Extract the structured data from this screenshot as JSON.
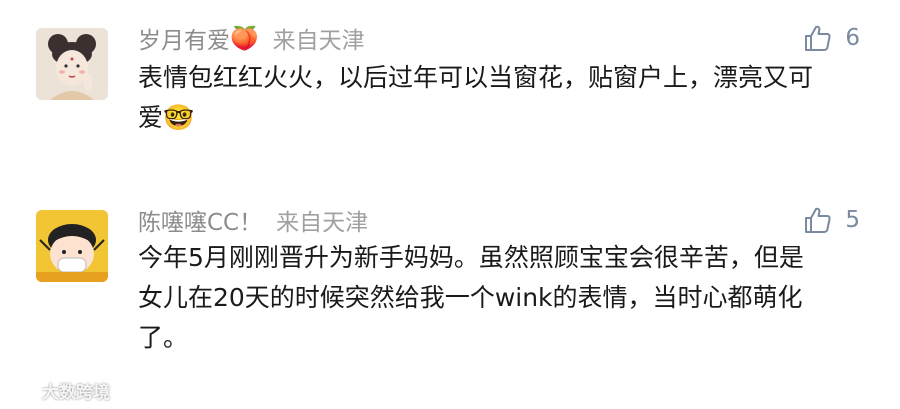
{
  "comments": [
    {
      "author": "岁月有爱",
      "author_emoji": "🍑",
      "location": "来自天津",
      "likes": "6",
      "text": "表情包红红火火，以后过年可以当窗花，贴窗户上，漂亮又可爱",
      "text_emoji": "🤓"
    },
    {
      "author": "陈噻噻CC！",
      "location": "来自天津",
      "likes": "5",
      "text": "今年5月刚刚晋升为新手妈妈。虽然照顾宝宝会很辛苦，但是女儿在20天的时候突然给我一个wink的表情，当时心都萌化了。"
    }
  ],
  "watermark": {
    "text": "大数跨境"
  },
  "colors": {
    "meta": "#8c8c8c",
    "body_text": "#1a1a1a",
    "like_icon": "#7a8aa0"
  }
}
